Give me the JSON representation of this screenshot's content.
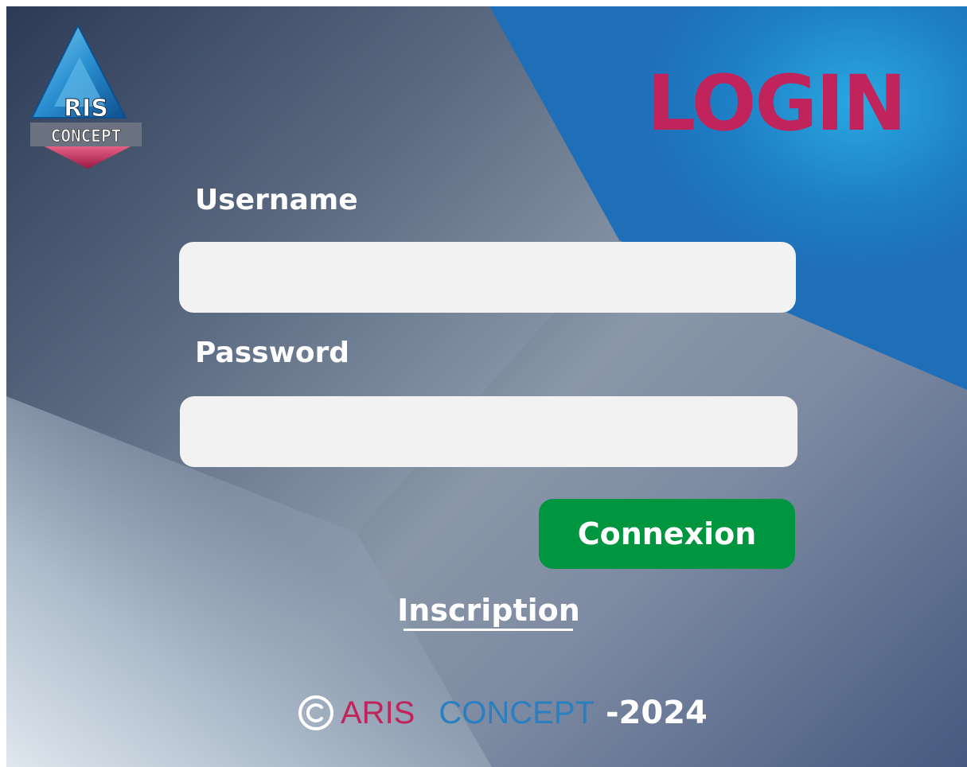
{
  "header": {
    "title": "LOGIN",
    "logo_text_top": "RIS",
    "logo_text_bottom": "CONCEPT"
  },
  "form": {
    "username_label": "Username",
    "username_value": "",
    "password_label": "Password",
    "password_value": "",
    "submit_label": "Connexion",
    "register_link": "Inscription"
  },
  "footer": {
    "copyright_symbol": "©",
    "brand_part1": "ARIS",
    "brand_part2": "CONCEPT",
    "year": "-2024"
  },
  "colors": {
    "title": "#c0245a",
    "submit_button": "#009640",
    "brand_aris": "#c0245a",
    "brand_concept": "#2a7fc0",
    "input_background": "#f2f2f2"
  },
  "icons": {
    "logo": "aris-concept-logo",
    "copyright": "copyright-icon"
  }
}
